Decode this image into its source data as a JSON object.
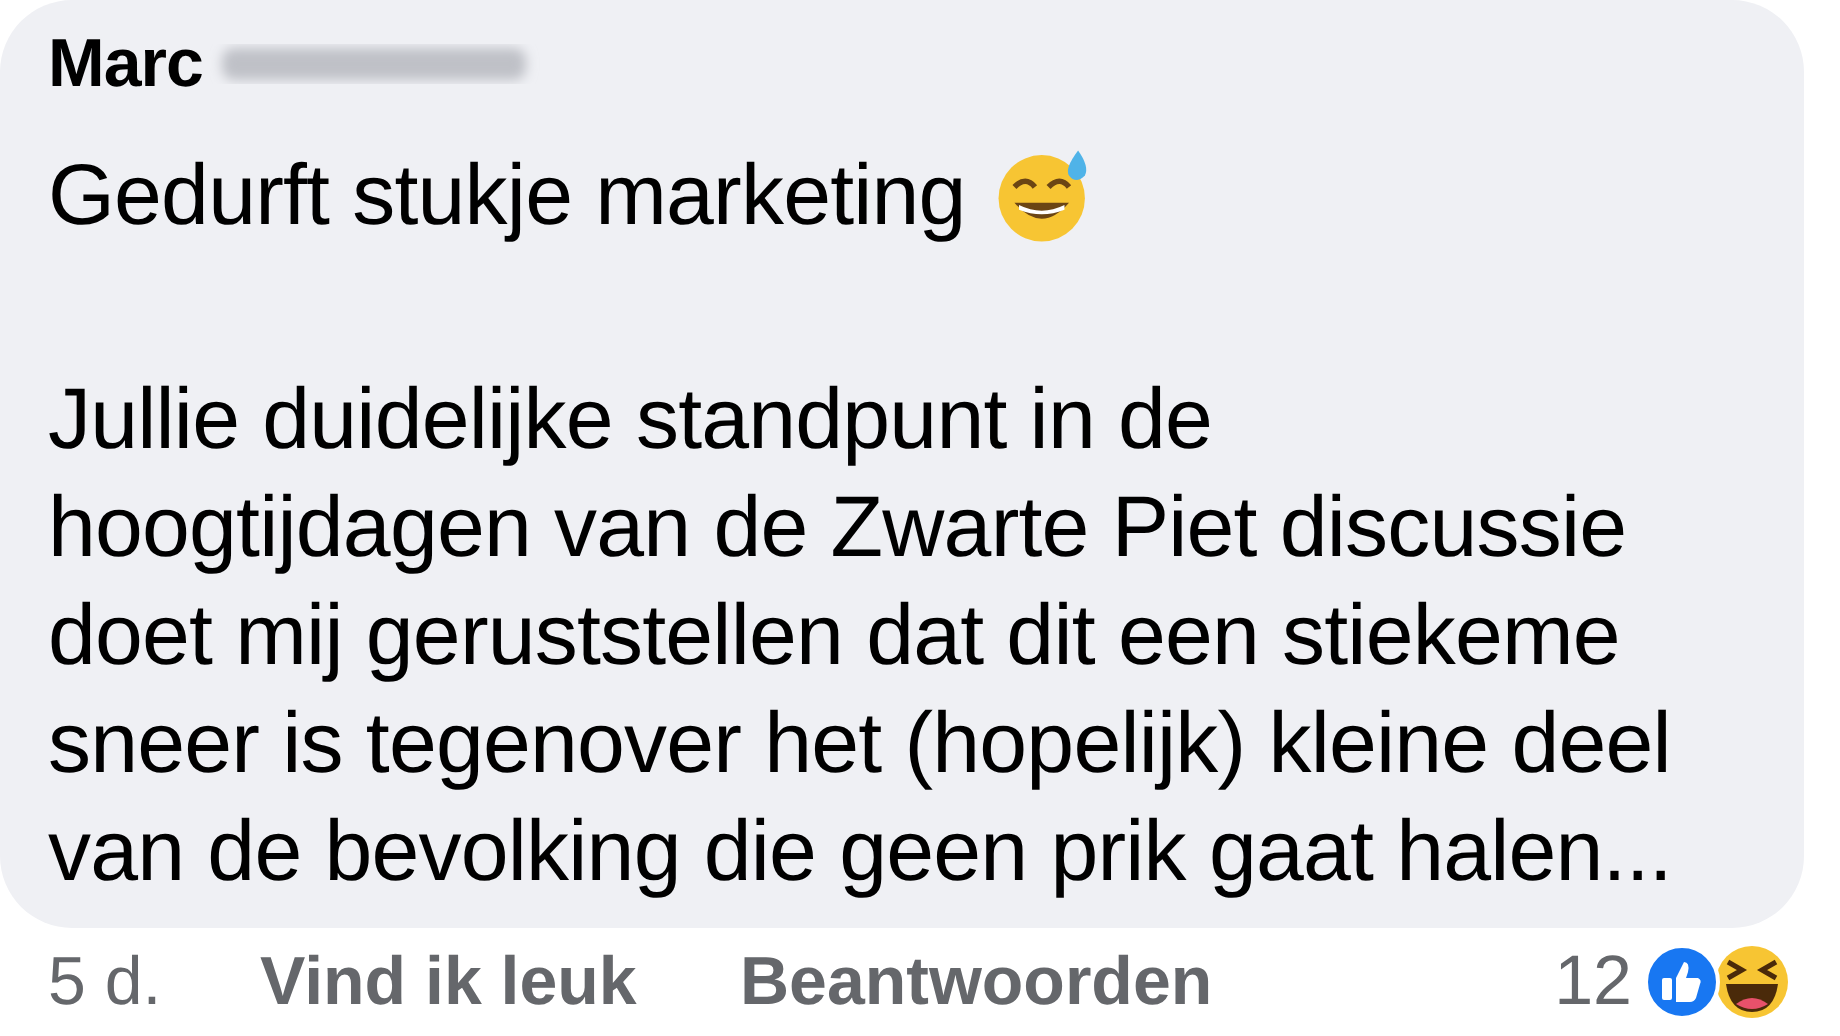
{
  "comment": {
    "author": "Marc",
    "author_surname_blurred": true,
    "paragraphs": [
      {
        "lines": [
          "Gedurft stukje marketing"
        ],
        "emoji": true
      },
      {
        "lines": [
          "Jullie duidelijke standpunt in de",
          "hoogtijdagen van de Zwarte Piet discussie",
          "doet mij geruststellen dat dit een stiekeme",
          "sneer is tegenover het (hopelijk) kleine deel",
          "van de bevolking die geen prik gaat halen..."
        ]
      }
    ]
  },
  "footer": {
    "time": "5 d.",
    "like": "Vind ik leuk",
    "reply": "Beantwoorden",
    "reaction_count": "12",
    "reactions": [
      {
        "kind": "like"
      },
      {
        "kind": "haha"
      }
    ]
  }
}
